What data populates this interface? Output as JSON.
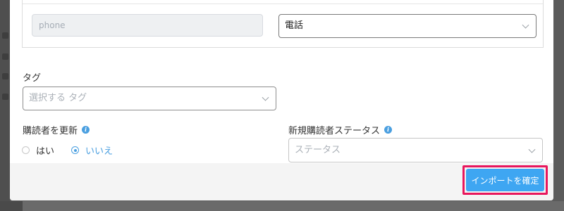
{
  "mapping": {
    "source_placeholder": "phone",
    "target_value": "電話"
  },
  "tags": {
    "label": "タグ",
    "placeholder": "選択する タグ"
  },
  "update_subscribers": {
    "label": "購読者を更新",
    "options": [
      "はい",
      "いいえ"
    ],
    "selected": "いいえ"
  },
  "new_subscriber_status": {
    "label": "新規購読者ステータス",
    "placeholder": "ステータス"
  },
  "footer": {
    "confirm_label": "インポートを確定"
  },
  "colors": {
    "accent": "#3ea6f2",
    "highlight": "#e8175d",
    "info": "#4a9fe0"
  }
}
